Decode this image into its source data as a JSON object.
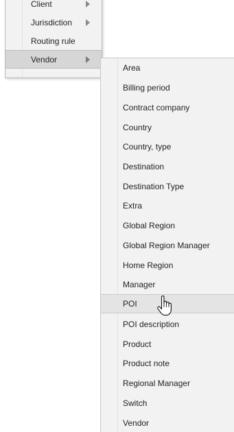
{
  "parent_menu": {
    "items": [
      {
        "label": "Client",
        "has_submenu": true
      },
      {
        "label": "Jurisdiction",
        "has_submenu": true
      },
      {
        "label": "Routing rule",
        "has_submenu": false
      },
      {
        "label": "Vendor",
        "has_submenu": true,
        "active": true
      }
    ]
  },
  "submenu": {
    "hovered": "POI",
    "items": [
      "Area",
      "Billing period",
      "Contract company",
      "Country",
      "Country, type",
      "Destination",
      "Destination Type",
      "Extra",
      "Global Region",
      "Global Region Manager",
      "Home Region",
      "Manager",
      "POI",
      "POI description",
      "Product",
      "Product note",
      "Regional Manager",
      "Switch",
      "Vendor"
    ]
  },
  "cursor": {
    "icon": "hand-pointer-icon"
  },
  "colors": {
    "menu_bg": "#f2f2f2",
    "active_bg": "#d6d6d6",
    "hover_bg": "#e4e4e4",
    "border": "#b8b8b8",
    "arrow": "#8a8a8a",
    "text": "#222222"
  }
}
